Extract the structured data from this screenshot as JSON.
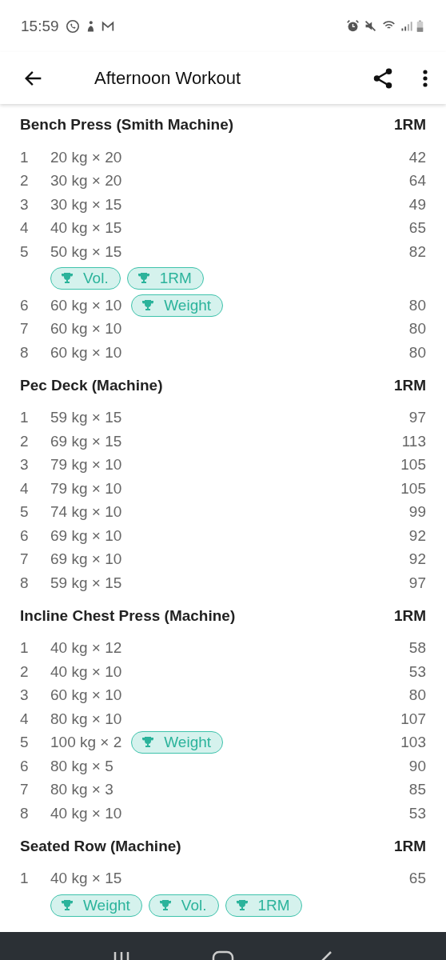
{
  "status_bar": {
    "time": "15:59"
  },
  "app_bar": {
    "title": "Afternoon Workout"
  },
  "exercises": [
    {
      "name": "Bench Press (Smith Machine)",
      "column": "1RM",
      "sets": [
        {
          "number": "1",
          "weight": "20 kg × 20",
          "value": "42"
        },
        {
          "number": "2",
          "weight": "30 kg × 20",
          "value": "64"
        },
        {
          "number": "3",
          "weight": "30 kg × 15",
          "value": "49"
        },
        {
          "number": "4",
          "weight": "40 kg × 15",
          "value": "65"
        },
        {
          "number": "5",
          "weight": "50 kg × 15",
          "value": "82",
          "records_below": [
            "Vol.",
            "1RM"
          ]
        },
        {
          "number": "6",
          "weight": "60 kg × 10",
          "value": "80",
          "records": [
            "Weight"
          ]
        },
        {
          "number": "7",
          "weight": "60 kg × 10",
          "value": "80"
        },
        {
          "number": "8",
          "weight": "60 kg × 10",
          "value": "80"
        }
      ]
    },
    {
      "name": "Pec Deck (Machine)",
      "column": "1RM",
      "sets": [
        {
          "number": "1",
          "weight": "59 kg × 15",
          "value": "97"
        },
        {
          "number": "2",
          "weight": "69 kg × 15",
          "value": "113"
        },
        {
          "number": "3",
          "weight": "79 kg × 10",
          "value": "105"
        },
        {
          "number": "4",
          "weight": "79 kg × 10",
          "value": "105"
        },
        {
          "number": "5",
          "weight": "74 kg × 10",
          "value": "99"
        },
        {
          "number": "6",
          "weight": "69 kg × 10",
          "value": "92"
        },
        {
          "number": "7",
          "weight": "69 kg × 10",
          "value": "92"
        },
        {
          "number": "8",
          "weight": "59 kg × 15",
          "value": "97"
        }
      ]
    },
    {
      "name": "Incline Chest Press (Machine)",
      "column": "1RM",
      "sets": [
        {
          "number": "1",
          "weight": "40 kg × 12",
          "value": "58"
        },
        {
          "number": "2",
          "weight": "40 kg × 10",
          "value": "53"
        },
        {
          "number": "3",
          "weight": "60 kg × 10",
          "value": "80"
        },
        {
          "number": "4",
          "weight": "80 kg × 10",
          "value": "107"
        },
        {
          "number": "5",
          "weight": "100 kg × 2",
          "value": "103",
          "records": [
            "Weight"
          ]
        },
        {
          "number": "6",
          "weight": "80 kg × 5",
          "value": "90"
        },
        {
          "number": "7",
          "weight": "80 kg × 3",
          "value": "85"
        },
        {
          "number": "8",
          "weight": "40 kg × 10",
          "value": "53"
        }
      ]
    },
    {
      "name": "Seated Row (Machine)",
      "column": "1RM",
      "sets": [
        {
          "number": "1",
          "weight": "40 kg × 15",
          "value": "65",
          "records_below": [
            "Weight",
            "Vol.",
            "1RM"
          ]
        }
      ]
    }
  ]
}
